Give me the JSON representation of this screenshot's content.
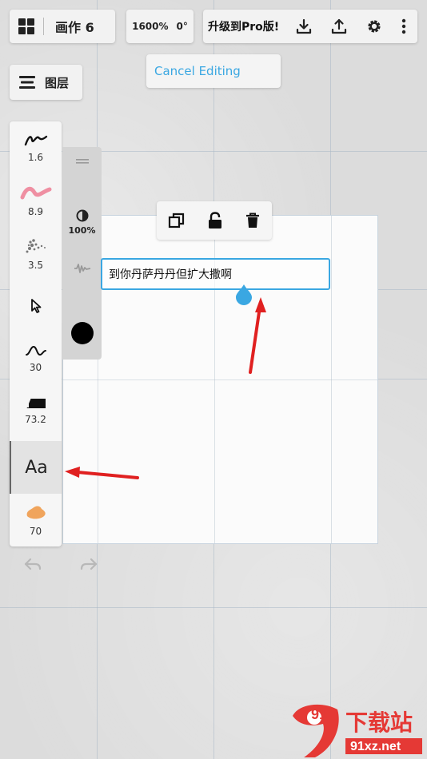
{
  "header": {
    "document_title": "画作 6",
    "zoom": "1600%",
    "rotation": "0°",
    "pro_label": "升级到Pro版!"
  },
  "cancel_editing": "Cancel Editing",
  "layers_label": "图层",
  "tools": [
    {
      "name": "pen",
      "value": "1.6"
    },
    {
      "name": "brush",
      "value": "8.9"
    },
    {
      "name": "texture",
      "value": "3.5"
    },
    {
      "name": "select",
      "value": ""
    },
    {
      "name": "smoothing",
      "value": "30"
    },
    {
      "name": "eraser",
      "value": "73.2"
    },
    {
      "name": "text",
      "value": ""
    },
    {
      "name": "blender",
      "value": "70"
    }
  ],
  "text_tool_label": "Aa",
  "opacity": "100%",
  "text_box": {
    "content": "到你丹萨丹丹但扩大撒啊"
  },
  "watermark": {
    "logo_text": "91",
    "site_cn": "下载站",
    "site_url": "91xz.net"
  },
  "colors": {
    "accent": "#3aa7e2",
    "arrow": "#e02020",
    "brush_pink": "#ef8fa2",
    "blender_orange": "#f0a45c",
    "current_color": "#000000"
  }
}
